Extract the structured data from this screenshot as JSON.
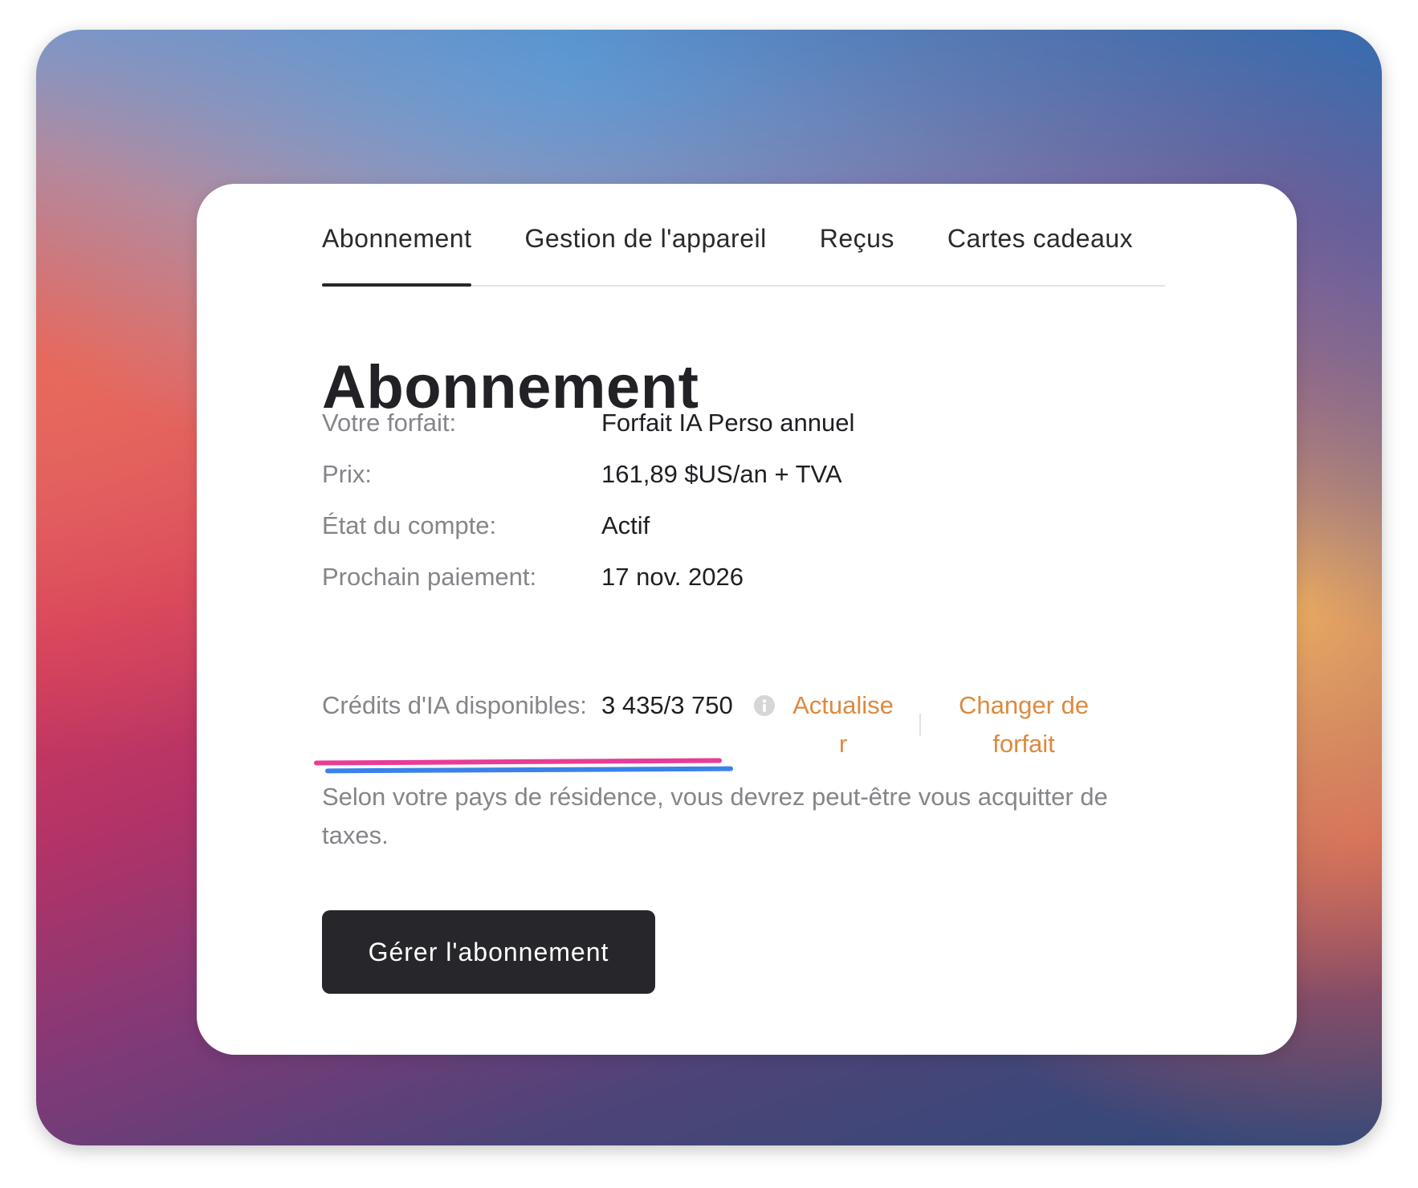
{
  "tabs": [
    {
      "label": "Abonnement",
      "active": true
    },
    {
      "label": "Gestion de l'appareil",
      "active": false
    },
    {
      "label": "Reçus",
      "active": false
    },
    {
      "label": "Cartes cadeaux",
      "active": false
    }
  ],
  "page_title": "Abonnement",
  "details": {
    "plan": {
      "label": "Votre forfait:",
      "value": "Forfait IA Perso annuel"
    },
    "price": {
      "label": "Prix:",
      "value": "161,89 $US/an + TVA"
    },
    "status": {
      "label": "État du compte:",
      "value": "Actif"
    },
    "next_payment": {
      "label": "Prochain paiement:",
      "value": "17 nov. 2026"
    },
    "credits": {
      "label": "Crédits d'IA disponibles:",
      "value": "3 435/3 750",
      "used": 3435,
      "total": 3750
    }
  },
  "links": {
    "refresh": "Actualiser",
    "change_plan": "Changer de forfait"
  },
  "tax_note": "Selon votre pays de résidence, vous devrez peut-être vous acquitter de taxes.",
  "manage_button": "Gérer l'abonnement",
  "colors": {
    "accent_link": "#dc8a3e",
    "button_bg": "#27272b",
    "annotation_pink": "#e83c96",
    "annotation_blue": "#3b82e8"
  },
  "icons": {
    "info": "info-icon"
  }
}
